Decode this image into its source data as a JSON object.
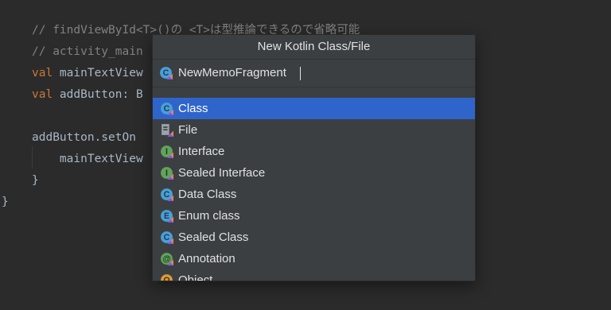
{
  "editor": {
    "lines": [
      {
        "text": "// findViewById<T>()の <T>は型推論できるので省略可能",
        "kind": "comment"
      },
      {
        "text": "// activity_main",
        "kind": "comment"
      },
      {
        "keyword": "val ",
        "text": "mainTextView",
        "kind": "decl"
      },
      {
        "keyword": "val ",
        "text": "addButton: B",
        "kind": "decl"
      },
      {
        "text": "",
        "kind": "plain"
      },
      {
        "text": "addButton.setOn",
        "kind": "plain"
      },
      {
        "text": "    mainTextView",
        "kind": "plain"
      },
      {
        "text": "}",
        "kind": "plain"
      },
      {
        "text": "}",
        "kind": "plain"
      }
    ]
  },
  "dialog": {
    "title": "New Kotlin Class/File",
    "name_value": "NewMemoFragment",
    "name_icon": "kotlin-class-icon",
    "items": [
      {
        "label": "Class",
        "icon": "kotlin-class-icon",
        "color": "#4a9fd8",
        "selected": true
      },
      {
        "label": "File",
        "icon": "kotlin-file-icon",
        "color": "#8a9099",
        "selected": false
      },
      {
        "label": "Interface",
        "icon": "kotlin-interface-icon",
        "color": "#62a35c",
        "selected": false
      },
      {
        "label": "Sealed Interface",
        "icon": "kotlin-sealed-interface-icon",
        "color": "#62a35c",
        "selected": false
      },
      {
        "label": "Data Class",
        "icon": "kotlin-data-class-icon",
        "color": "#4a9fd8",
        "selected": false
      },
      {
        "label": "Enum class",
        "icon": "kotlin-enum-icon",
        "color": "#4a9fd8",
        "selected": false
      },
      {
        "label": "Sealed Class",
        "icon": "kotlin-sealed-class-icon",
        "color": "#4a9fd8",
        "selected": false
      },
      {
        "label": "Annotation",
        "icon": "kotlin-annotation-icon",
        "color": "#62a35c",
        "selected": false
      },
      {
        "label": "Object",
        "icon": "kotlin-object-icon",
        "color": "#d99a3e",
        "selected": false
      }
    ]
  },
  "colors": {
    "editor_bg": "#2b2b2b",
    "dialog_bg": "#3c3f41",
    "selection": "#2f65ca",
    "comment": "#808080",
    "keyword": "#cc7832"
  }
}
